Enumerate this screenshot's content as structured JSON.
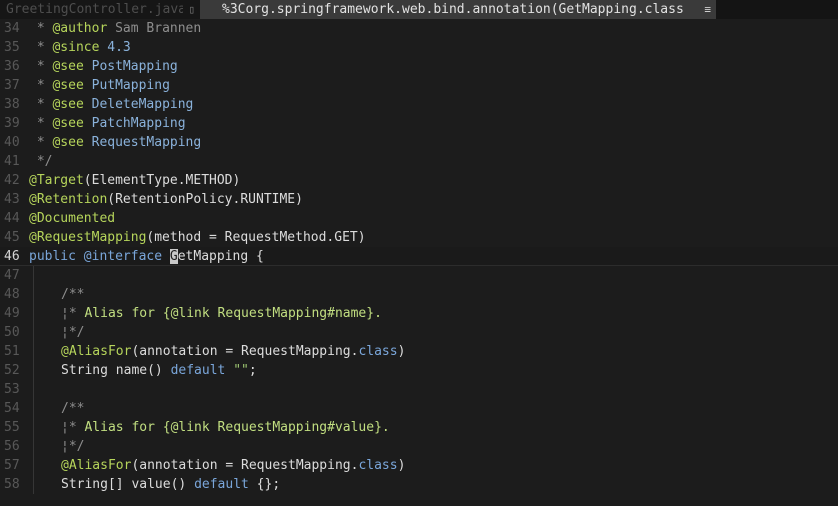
{
  "tabs": [
    {
      "label": "GreetingController.java",
      "icon": "page-icon",
      "active": false
    },
    {
      "label": "%3Corg.springframework.web.bind.annotation(GetMapping.class",
      "icon": "menu-icon",
      "active": true
    }
  ],
  "colors": {
    "background": "#1c1c1c",
    "comment": "#8e8e8e",
    "doc_tag": "#b6d55b",
    "link": "#8ab2db",
    "keyword": "#7aa6da"
  },
  "editor": {
    "current_line": 46,
    "lines": [
      {
        "num": "34",
        "t": [
          " * ",
          "@author",
          " Sam Brannen"
        ]
      },
      {
        "num": "35",
        "t": [
          " * ",
          "@since",
          " 4.3"
        ]
      },
      {
        "num": "36",
        "t": [
          " * ",
          "@see",
          " ",
          "PostMapping"
        ]
      },
      {
        "num": "37",
        "t": [
          " * ",
          "@see",
          " ",
          "PutMapping"
        ]
      },
      {
        "num": "38",
        "t": [
          " * ",
          "@see",
          " ",
          "DeleteMapping"
        ]
      },
      {
        "num": "39",
        "t": [
          " * ",
          "@see",
          " ",
          "PatchMapping"
        ]
      },
      {
        "num": "40",
        "t": [
          " * ",
          "@see",
          " ",
          "RequestMapping"
        ]
      },
      {
        "num": "41",
        "t": [
          " */"
        ]
      },
      {
        "num": "42",
        "t": [
          "@Target",
          "(ElementType.METHOD)"
        ]
      },
      {
        "num": "43",
        "t": [
          "@Retention",
          "(RetentionPolicy.RUNTIME)"
        ]
      },
      {
        "num": "44",
        "t": [
          "@Documented"
        ]
      },
      {
        "num": "45",
        "t": [
          "@RequestMapping",
          "(method = RequestMethod.GET)"
        ]
      },
      {
        "num": "46",
        "t": [
          "public",
          " ",
          "@interface",
          " ",
          "G",
          "etMapping {"
        ]
      },
      {
        "num": "47",
        "t": []
      },
      {
        "num": "48",
        "t": [
          "/**"
        ]
      },
      {
        "num": "49",
        "t": [
          "¦",
          "* ",
          "Alias for {@link RequestMapping#name}."
        ]
      },
      {
        "num": "50",
        "t": [
          "¦",
          "*/"
        ]
      },
      {
        "num": "51",
        "t": [
          "@AliasFor",
          "(annotation = RequestMapping.",
          "class",
          ")"
        ]
      },
      {
        "num": "52",
        "t": [
          "String name() ",
          "default",
          " ",
          "\"\"",
          ";"
        ]
      },
      {
        "num": "53",
        "t": []
      },
      {
        "num": "54",
        "t": [
          "/**"
        ]
      },
      {
        "num": "55",
        "t": [
          "¦",
          "* ",
          "Alias for {@link RequestMapping#value}."
        ]
      },
      {
        "num": "56",
        "t": [
          "¦",
          "*/"
        ]
      },
      {
        "num": "57",
        "t": [
          "@AliasFor",
          "(annotation = RequestMapping.",
          "class",
          ")"
        ]
      },
      {
        "num": "58",
        "t": [
          "String[] value() ",
          "default",
          " {};"
        ]
      }
    ]
  }
}
